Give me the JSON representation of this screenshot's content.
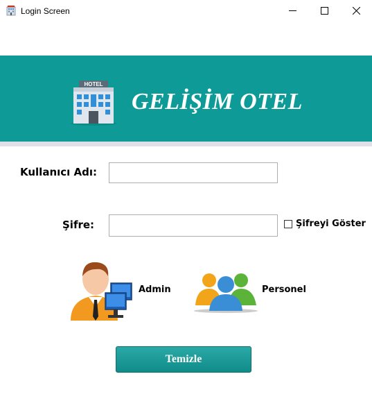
{
  "window": {
    "title": "Login Screen",
    "icon": "hotel-icon",
    "controls": [
      "minimize-icon",
      "maximize-icon",
      "close-icon"
    ]
  },
  "header": {
    "hotel_name": "GELİŞİM OTEL",
    "icon": "hotel-building-icon",
    "icon_sign": "HOTEL",
    "background_color": "#0e9b98"
  },
  "form": {
    "username_label": "Kullanıcı Adı:",
    "username_value": "",
    "password_label": "Şifre:",
    "password_value": "",
    "show_password_label": "Şifreyi Göster",
    "show_password_checked": false
  },
  "roles": [
    {
      "label": "Admin",
      "icon": "admin-user-icon"
    },
    {
      "label": "Personel",
      "icon": "staff-group-icon"
    }
  ],
  "actions": {
    "clear_label": "Temizle"
  }
}
